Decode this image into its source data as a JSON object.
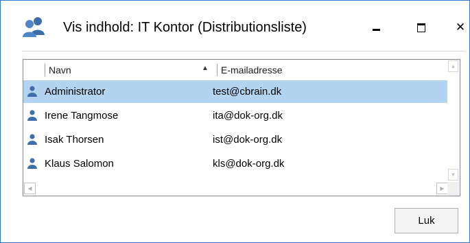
{
  "window": {
    "title": "Vis indhold: IT Kontor (Distributionsliste)",
    "icon": "people-group-icon",
    "controls": {
      "minimize": "minimize-icon",
      "maximize": "maximize-icon",
      "close": "close-icon",
      "close_glyph": "✕"
    }
  },
  "list": {
    "columns": [
      {
        "label": "Navn",
        "sort": "ascending"
      },
      {
        "label": "E-mailadresse"
      }
    ],
    "sort_indicator": "▲",
    "rows": [
      {
        "name": "Administrator",
        "email": "test@cbrain.dk",
        "selected": true
      },
      {
        "name": "Irene Tangmose",
        "email": "ita@dok-org.dk",
        "selected": false
      },
      {
        "name": "Isak Thorsen",
        "email": "ist@dok-org.dk",
        "selected": false
      },
      {
        "name": "Klaus Salomon",
        "email": "kls@dok-org.dk",
        "selected": false
      }
    ],
    "scroll_glyphs": {
      "up": "▲",
      "down": "▼",
      "left": "◀",
      "right": "▶"
    }
  },
  "buttons": {
    "close_label": "Luk"
  },
  "colors": {
    "accent": "#2b7bd3",
    "selection": "#b3d4f0",
    "person_icon": "#3f6fa8"
  }
}
